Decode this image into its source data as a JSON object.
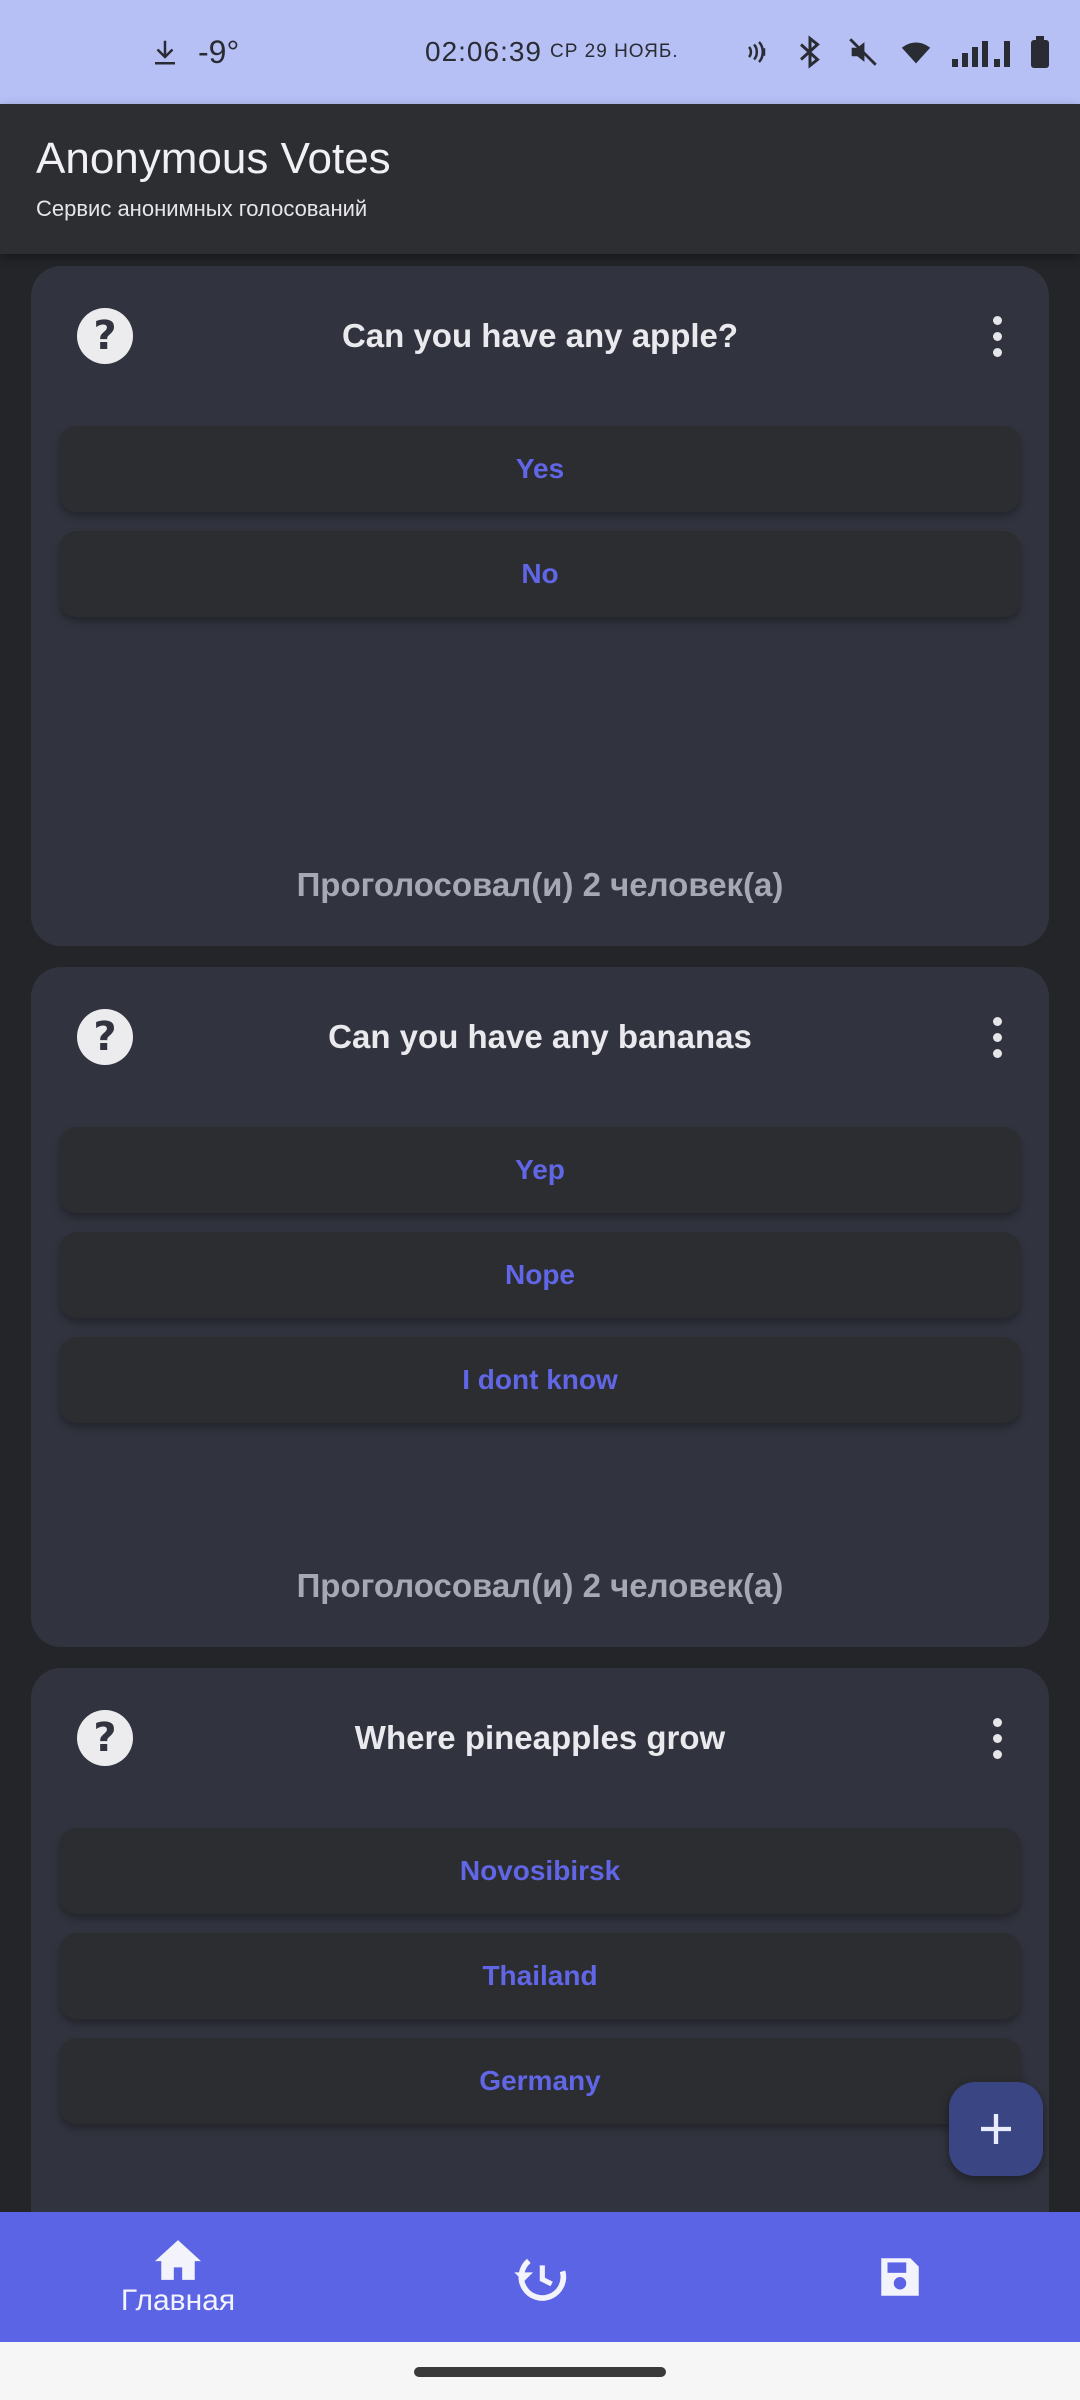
{
  "status_bar": {
    "temperature": "-9°",
    "time": "02:06:39",
    "date": "СР 29 НОЯБ.",
    "icons": [
      "download-icon",
      "nfc-icon",
      "bluetooth-icon",
      "mute-icon",
      "wifi-icon",
      "signal-icon",
      "battery-icon"
    ]
  },
  "app_bar": {
    "title": "Anonymous Votes",
    "subtitle": "Сервис анонимных голосований"
  },
  "polls": [
    {
      "question": "Can you have any apple?",
      "options": [
        "Yes",
        "No"
      ],
      "votes_text": "Проголосовал(и) 2 человек(а)"
    },
    {
      "question": "Can you have any bananas",
      "options": [
        "Yep",
        "Nope",
        "I dont know"
      ],
      "votes_text": "Проголосовал(и) 2 человек(а)"
    },
    {
      "question": "Where pineapples grow",
      "options": [
        "Novosibirsk",
        "Thailand",
        "Germany"
      ]
    }
  ],
  "help_glyph": "?",
  "fab_icon": "plus-icon",
  "bottom_nav": {
    "items": [
      {
        "icon": "home-icon",
        "label": "Главная",
        "active": true
      },
      {
        "icon": "history-icon",
        "label": ""
      },
      {
        "icon": "save-icon",
        "label": ""
      }
    ]
  },
  "colors": {
    "status_bar": "#b6c0f5",
    "app_bar": "#2d2e32",
    "card": "#31333e",
    "option_text": "#6066e6",
    "bottom_nav": "#5c64e6",
    "fab": "#3a4584"
  }
}
